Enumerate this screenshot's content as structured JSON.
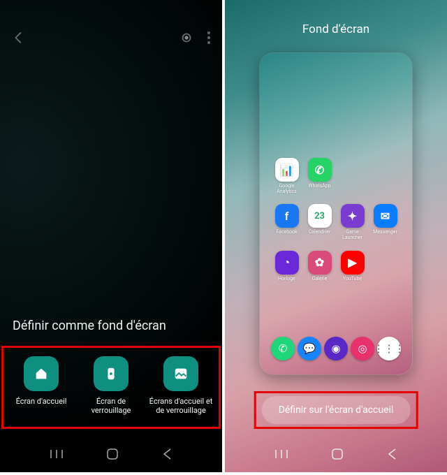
{
  "left": {
    "sheet_title": "Définir comme fond d'écran",
    "choices": [
      {
        "label": "Écran d'accueil",
        "icon": "home-icon"
      },
      {
        "label": "Écran de\nverrouillage",
        "icon": "lock-icon"
      },
      {
        "label": "Écrans d'accueil et\nde verrouillage",
        "icon": "picture-icon"
      }
    ],
    "topbar": {
      "back": "back-icon",
      "link": "link-icon",
      "more": "more-icon"
    }
  },
  "right": {
    "title": "Fond d'écran",
    "set_button": "Définir sur l'écran d'accueil",
    "apps": [
      {
        "label": "Google\nAnalytics",
        "bg": "#ffffff",
        "glyph": "📊",
        "fg": "#444"
      },
      {
        "label": "WhatsApp",
        "bg": "#25D366",
        "glyph": "✆"
      },
      {
        "label": "",
        "bg": "",
        "glyph": ""
      },
      {
        "label": "",
        "bg": "",
        "glyph": ""
      },
      {
        "label": "Facebook",
        "bg": "#1877F2",
        "glyph": "f"
      },
      {
        "label": "Calendrier",
        "bg": "#ffffff",
        "glyph": "23",
        "fg": "#1aa05a"
      },
      {
        "label": "Game\nLauncher",
        "bg": "#7a3bd0",
        "glyph": "✦"
      },
      {
        "label": "Messenger",
        "bg": "#0a7cff",
        "glyph": "✉"
      },
      {
        "label": "Horloge",
        "bg": "#6a28d9",
        "glyph": "◔"
      },
      {
        "label": "Galerie",
        "bg": "#d94a7a",
        "glyph": "✿"
      },
      {
        "label": "YouTube",
        "bg": "#ff0000",
        "glyph": "▶"
      },
      {
        "label": "",
        "bg": "",
        "glyph": ""
      }
    ],
    "dock": [
      {
        "name": "phone-icon",
        "bg": "#1fd67a",
        "glyph": "✆"
      },
      {
        "name": "messages-icon",
        "bg": "#1784ff",
        "glyph": "💬"
      },
      {
        "name": "browser-icon",
        "bg": "#5a28c8",
        "glyph": "◉"
      },
      {
        "name": "camera-icon",
        "bg": "#e8326e",
        "glyph": "◎"
      },
      {
        "name": "apps-icon",
        "bg": "#ffffff",
        "glyph": "⋮⋮⋮"
      }
    ]
  },
  "navbar_icons": [
    "recent-apps-icon",
    "home-icon",
    "back-icon"
  ]
}
